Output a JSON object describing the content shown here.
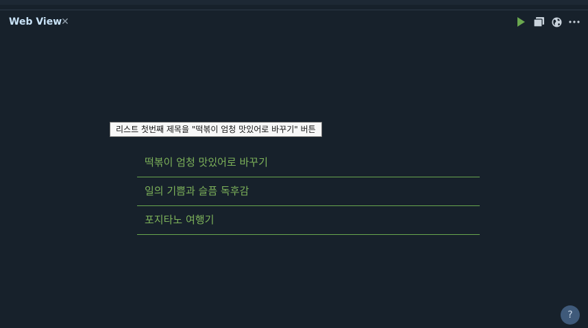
{
  "tab": {
    "title": "Web View",
    "close_icon": "close-icon"
  },
  "toolbar": {
    "icons": [
      "play-icon",
      "copy-icon",
      "globe-icon",
      "more-icon"
    ],
    "play_color": "#6aa84f"
  },
  "tooltip": {
    "text": "리스트 첫번째 제목을 \"떡볶이 엄청 맛있어로 바꾸기\" 버튼"
  },
  "list": {
    "items": [
      {
        "label": "떡볶이 엄청 맛있어로 바꾸기"
      },
      {
        "label": "일의 기쁨과 슬픔 독후감"
      },
      {
        "label": "포지타노 여행기"
      }
    ],
    "accent": "#7db25a"
  },
  "help": {
    "label": "?"
  }
}
